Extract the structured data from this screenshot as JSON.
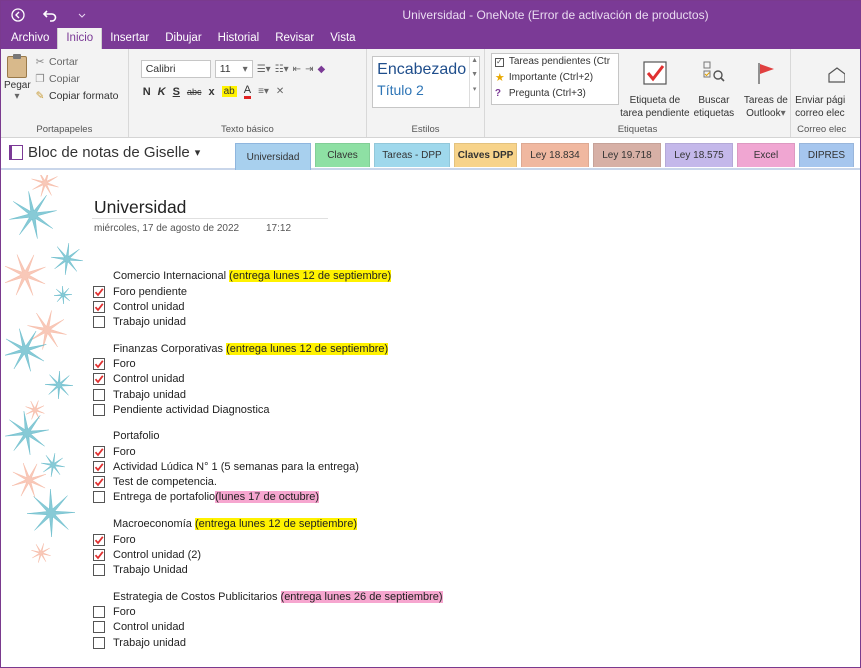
{
  "window": {
    "title": "Universidad  -  OneNote (Error de activación de productos)",
    "back_icon": "back-arrow-icon",
    "undo_icon": "undo-icon",
    "qa_dropdown": "chevron-down-icon"
  },
  "menu_tabs": [
    "Archivo",
    "Inicio",
    "Insertar",
    "Dibujar",
    "Historial",
    "Revisar",
    "Vista"
  ],
  "ribbon": {
    "clipboard": {
      "paste": "Pegar",
      "cut": "Cortar",
      "copy": "Copiar",
      "format_painter": "Copiar formato",
      "label": "Portapapeles"
    },
    "basic_text": {
      "font": "Calibri",
      "size": "11",
      "bold": "N",
      "italic": "K",
      "underline": "S",
      "strike": "abc",
      "subscript": "x",
      "highlight": "ab",
      "font_color": "A",
      "label": "Texto básico"
    },
    "styles": {
      "heading": "Encabezado",
      "title2": "Título 2",
      "label": "Estilos"
    },
    "tags": {
      "items": [
        "Tareas pendientes (Ctr",
        "Importante (Ctrl+2)",
        "Pregunta (Ctrl+3)"
      ],
      "todo_tag_line1": "Etiqueta de",
      "todo_tag_line2": "tarea pendiente",
      "find_line1": "Buscar",
      "find_line2": "etiquetas",
      "outlook_line1": "Tareas de",
      "outlook_line2": "Outlook",
      "label": "Etiquetas"
    },
    "email": {
      "line1": "Enviar pági",
      "line2": "correo elec",
      "label": "Correo elec"
    }
  },
  "notebook": {
    "name": "Bloc de notas de Giselle",
    "sections": [
      {
        "label": "Universidad",
        "color": "#a8d0ee",
        "active": true,
        "bold": false,
        "width": 76
      },
      {
        "label": "Claves",
        "color": "#8ee0a4",
        "active": false,
        "bold": false,
        "width": 55
      },
      {
        "label": "Tareas - DPP",
        "color": "#9fd8ec",
        "active": false,
        "bold": false,
        "width": 76
      },
      {
        "label": "Claves DPP",
        "color": "#f7d38a",
        "active": false,
        "bold": true,
        "width": 63
      },
      {
        "label": "Ley 18.834",
        "color": "#f0b8a0",
        "active": false,
        "bold": false,
        "width": 68
      },
      {
        "label": "Ley 19.718",
        "color": "#d7b0a6",
        "active": false,
        "bold": false,
        "width": 68
      },
      {
        "label": "Ley 18.575",
        "color": "#c4b8ea",
        "active": false,
        "bold": false,
        "width": 68
      },
      {
        "label": "Excel",
        "color": "#f0a6d2",
        "active": false,
        "bold": false,
        "width": 58
      },
      {
        "label": "DIPRES",
        "color": "#a6c6ee",
        "active": false,
        "bold": false,
        "width": 55
      }
    ]
  },
  "page": {
    "title": "Universidad",
    "date": "miércoles, 17 de agosto de 2022",
    "time": "17:12",
    "blocks": [
      {
        "heading": "Comercio Internacional ",
        "highlight": "(entrega lunes 12 de septiembre)",
        "hl_color": "yellow",
        "items": [
          {
            "text": "Foro pendiente",
            "checked": true
          },
          {
            "text": "Control unidad",
            "checked": true
          },
          {
            "text": "Trabajo unidad",
            "checked": false
          }
        ]
      },
      {
        "heading": "Finanzas Corporativas ",
        "highlight": "(entrega lunes 12 de septiembre)",
        "hl_color": "yellow",
        "items": [
          {
            "text": "Foro",
            "checked": true
          },
          {
            "text": "Control unidad",
            "checked": true
          },
          {
            "text": "Trabajo unidad",
            "checked": false
          },
          {
            "text": "Pendiente actividad Diagnostica",
            "checked": false
          }
        ]
      },
      {
        "heading": "Portafolio",
        "highlight": "",
        "hl_color": "",
        "items": [
          {
            "text": "Foro",
            "checked": true
          },
          {
            "text": "Actividad Lúdica N° 1 (5 semanas para la entrega)",
            "checked": true
          },
          {
            "text": "Test de competencia.",
            "checked": true
          },
          {
            "text": "Entrega de portafolio ",
            "checked": false,
            "highlight": "(lunes 17 de octubre)",
            "hl_color": "pink"
          }
        ]
      },
      {
        "heading": "Macroeconomía ",
        "highlight": "(entrega lunes 12 de septiembre)",
        "hl_color": "yellow",
        "items": [
          {
            "text": "Foro",
            "checked": true
          },
          {
            "text": "Control unidad (2)",
            "checked": true
          },
          {
            "text": "Trabajo Unidad",
            "checked": false
          }
        ]
      },
      {
        "heading": "Estrategia de Costos Publicitarios ",
        "highlight": "(entrega lunes 26 de septiembre)",
        "hl_color": "pink",
        "items": [
          {
            "text": "Foro",
            "checked": false
          },
          {
            "text": "Control unidad",
            "checked": false
          },
          {
            "text": "Trabajo unidad",
            "checked": false
          }
        ]
      }
    ]
  }
}
